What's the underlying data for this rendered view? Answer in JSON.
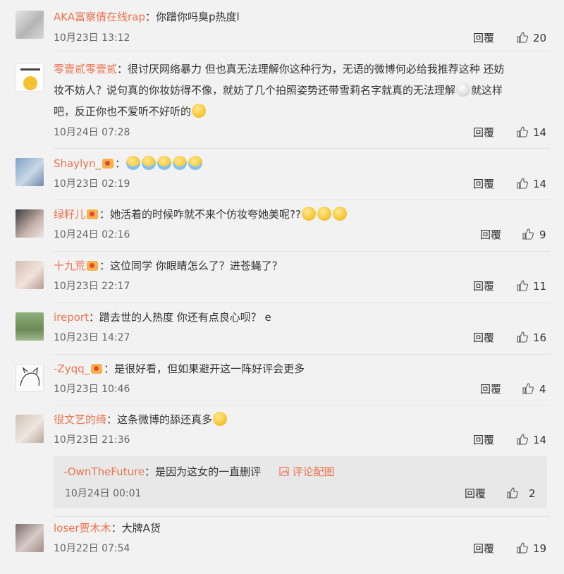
{
  "comments": [
    {
      "user": "AKA富察倩在线rap",
      "text": "：你蹭你吗臭p热度l",
      "time": "10月23日 13:12",
      "reply": "回覆",
      "likes": "20"
    },
    {
      "user": "零壹贰零壹贰",
      "text_l1": "：很讨厌网络暴力 但也真无法理解你这种行为，无语的微博何必给我推荐这种 还妨",
      "text_l2": "妆不妨人？说句真的你妆妨得不像，就妨了几个拍照姿势还带雪莉名字就真的无法理解",
      "text_l3a": "就这样",
      "text_l3b": "吧，反正你也不爱听不好听的",
      "time": "10月24日 07:28",
      "reply": "回覆",
      "likes": "14"
    },
    {
      "user": "Shaylyn_",
      "text": "：",
      "time": "10月23日 02:19",
      "reply": "回覆",
      "likes": "14"
    },
    {
      "user": "绿籽儿",
      "text": "：她活着的时候咋就不来个仿妆夸她美呢??",
      "time": "10月24日 02:16",
      "reply": "回覆",
      "likes": "9"
    },
    {
      "user": "十九荒",
      "text": "：这位同学 你眼睛怎么了？进苍蝇了？",
      "time": "10月23日 22:17",
      "reply": "回覆",
      "likes": "11"
    },
    {
      "user": "ireport",
      "text": "：蹭去世的人热度 你还有点良心呗？ e",
      "time": "10月23日 14:27",
      "reply": "回覆",
      "likes": "16"
    },
    {
      "user": "-Zyqq_",
      "text": "：是很好看，但如果避开这一阵好评会更多",
      "time": "10月23日 10:46",
      "reply": "回覆",
      "likes": "4"
    },
    {
      "user": "很文艺的绮",
      "text": "：这条微博的舔还真多",
      "time": "10月23日 21:36",
      "reply": "回覆",
      "likes": "14"
    },
    {
      "user": "loser贾木木",
      "text": "：大牌A货",
      "time": "10月22日 07:54",
      "reply": "回覆",
      "likes": "19"
    }
  ],
  "subreply": {
    "user": "-OwnTheFuture",
    "text": "：是因为这女的一直删评",
    "img_link": "评论配图",
    "time": "10月24日 00:01",
    "reply": "回覆",
    "likes": "2"
  },
  "colors": {
    "name": "#eb7350",
    "background": "#f2f2f2",
    "subreply_bg": "#e8e8e8"
  },
  "icons": {
    "like": "thumbs-up-icon",
    "image": "image-icon",
    "badge": "vip-badge-icon",
    "emoji": "emoji-icon"
  }
}
